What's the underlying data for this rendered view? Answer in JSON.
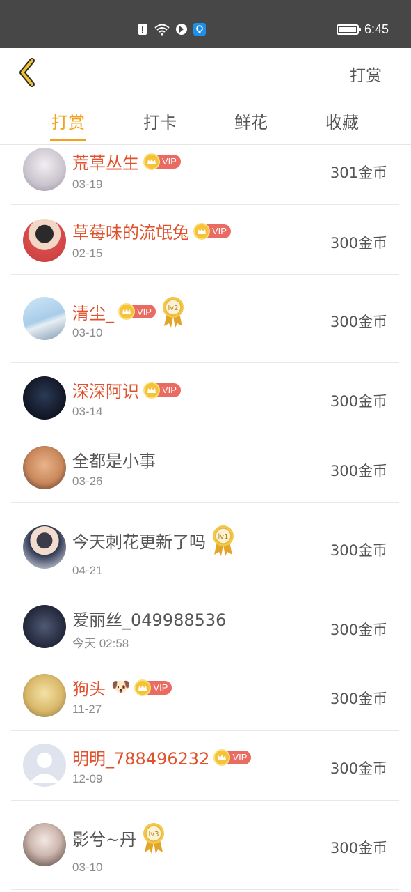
{
  "status_bar": {
    "time": "6:45"
  },
  "header": {
    "action_label": "打赏"
  },
  "tabs": [
    {
      "label": "打赏",
      "active": true
    },
    {
      "label": "打卡",
      "active": false
    },
    {
      "label": "鲜花",
      "active": false
    },
    {
      "label": "收藏",
      "active": false
    }
  ],
  "colors": {
    "accent": "#f3a01c",
    "vip_name": "#e0522d",
    "vip_badge": "#e96b62",
    "crown": "#f6c338"
  },
  "vip_label": "VIP",
  "list": [
    {
      "name": "荒草丛生",
      "date": "03-19",
      "amount": "301金币",
      "vip": true,
      "medal": null
    },
    {
      "name": "草莓味的流氓兔",
      "date": "02-15",
      "amount": "300金币",
      "vip": true,
      "medal": null
    },
    {
      "name": "清尘_",
      "date": "03-10",
      "amount": "300金币",
      "vip": true,
      "medal": "lv2"
    },
    {
      "name": "深深阿识",
      "date": "03-14",
      "amount": "300金币",
      "vip": true,
      "medal": null
    },
    {
      "name": "全都是小事",
      "date": "03-26",
      "amount": "300金币",
      "vip": false,
      "medal": null
    },
    {
      "name": "今天刺花更新了吗",
      "date": "04-21",
      "amount": "300金币",
      "vip": false,
      "medal": "lv1"
    },
    {
      "name": "爱丽丝_049988536",
      "date": "今天 02:58",
      "amount": "300金币",
      "vip": false,
      "medal": null
    },
    {
      "name": "狗头",
      "date": "11-27",
      "amount": "300金币",
      "vip": true,
      "medal": null,
      "emoji": "🐶"
    },
    {
      "name": "明明_788496232",
      "date": "12-09",
      "amount": "300金币",
      "vip": true,
      "medal": null
    },
    {
      "name": "影兮~丹",
      "date": "03-10",
      "amount": "300金币",
      "vip": false,
      "medal": "lv3"
    }
  ]
}
